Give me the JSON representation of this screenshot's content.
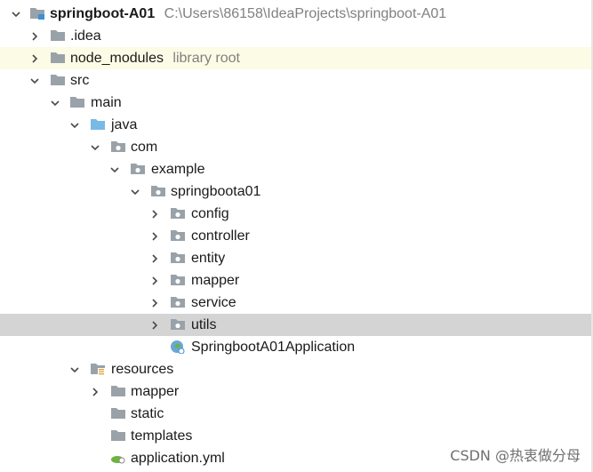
{
  "colors": {
    "folder_gray": "#9aa2a9",
    "folder_blue": "#79b9e6",
    "arrow": "#4a4a4a",
    "hint": "#808080",
    "row_library_bg": "#fcfbe6",
    "row_selected_bg": "#d4d4d4",
    "spring_green": "#6db33f"
  },
  "tree": {
    "root": {
      "name": "springboot-A01",
      "path": "C:\\Users\\86158\\IdeaProjects\\springboot-A01"
    },
    "idea": {
      "name": ".idea"
    },
    "node_modules": {
      "name": "node_modules",
      "hint": "library root"
    },
    "src": {
      "name": "src"
    },
    "main": {
      "name": "main"
    },
    "java": {
      "name": "java"
    },
    "com": {
      "name": "com"
    },
    "example": {
      "name": "example"
    },
    "springboota01": {
      "name": "springboota01"
    },
    "config": {
      "name": "config"
    },
    "controller": {
      "name": "controller"
    },
    "entity": {
      "name": "entity"
    },
    "mapper_pkg": {
      "name": "mapper"
    },
    "service": {
      "name": "service"
    },
    "utils": {
      "name": "utils"
    },
    "app_class": {
      "name": "SpringbootA01Application"
    },
    "resources": {
      "name": "resources"
    },
    "res_mapper": {
      "name": "mapper"
    },
    "static": {
      "name": "static"
    },
    "templates": {
      "name": "templates"
    },
    "application_yml": {
      "name": "application.yml"
    }
  },
  "watermark": "CSDN @热衷做分母"
}
